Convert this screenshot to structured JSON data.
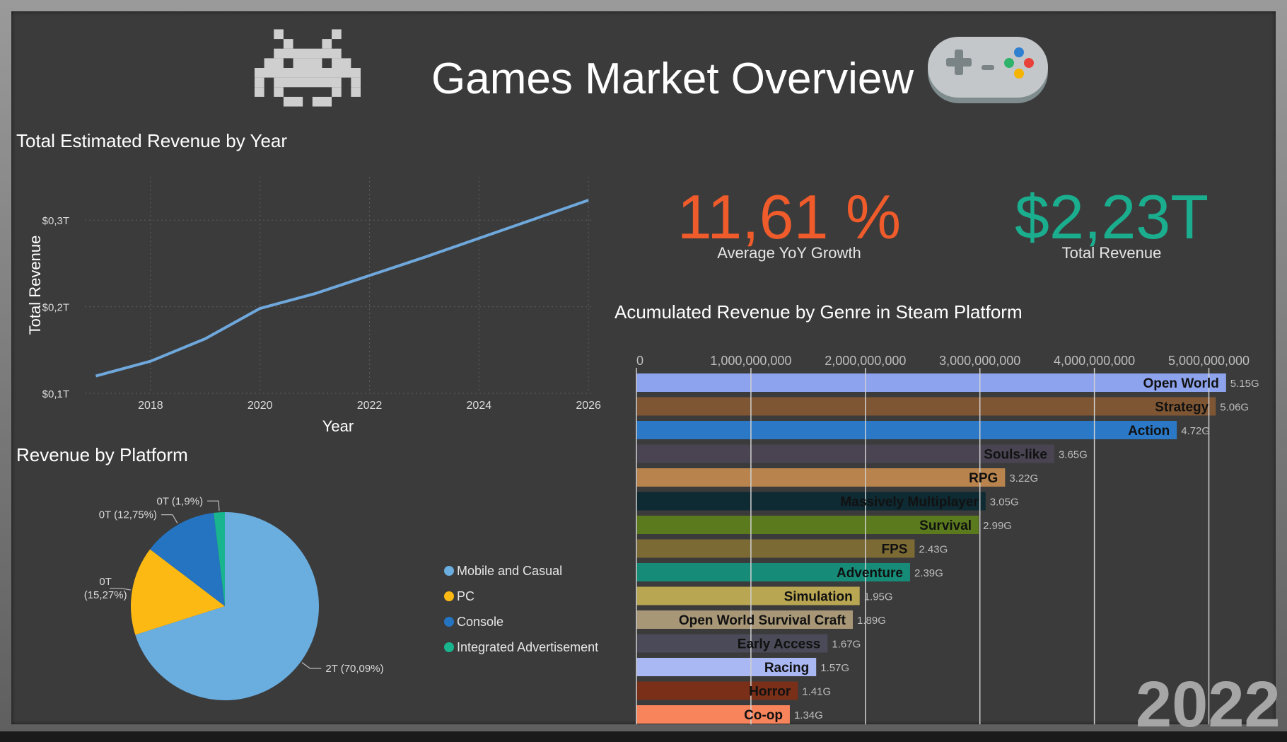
{
  "header": {
    "title": "Games Market Overview",
    "left_icon": "space-invader-icon",
    "right_icon": "gamepad-icon"
  },
  "kpis": {
    "growth": {
      "value": "11,61 %",
      "label": "Average YoY Growth",
      "color": "#ef5b2b"
    },
    "revenue": {
      "value": "$2,23T",
      "label": "Total Revenue",
      "color": "#1aae8f"
    }
  },
  "year_label": "2022",
  "line_chart_title": "Total Estimated Revenue by Year",
  "pie_chart_title": "Revenue by Platform",
  "bar_chart_title": "Acumulated Revenue by Genre in Steam Platform",
  "chart_data": [
    {
      "type": "line",
      "title": "Total Estimated Revenue by Year",
      "xlabel": "Year",
      "ylabel": "Total Revenue",
      "x": [
        2017,
        2018,
        2019,
        2020,
        2021,
        2022,
        2023,
        2024,
        2025,
        2026
      ],
      "series": [
        {
          "values": [
            0.12,
            0.137,
            0.163,
            0.198,
            0.215,
            0.236,
            0.257,
            0.279,
            0.301,
            0.323
          ]
        }
      ],
      "xticks": [
        "2018",
        "2020",
        "2022",
        "2024",
        "2026"
      ],
      "yticks": [
        "$0,1T",
        "$0,2T",
        "$0,3T"
      ],
      "ytick_values": [
        0.1,
        0.2,
        0.3
      ],
      "xlim": [
        2016.8,
        2026.05
      ],
      "ylim": [
        0.1,
        0.35
      ],
      "grid": true,
      "color": "#6fa8dc"
    },
    {
      "type": "pie",
      "title": "Revenue by Platform",
      "categories": [
        "Mobile and Casual",
        "PC",
        "Console",
        "Integrated Advertisement"
      ],
      "values": [
        70.09,
        15.27,
        12.75,
        1.9
      ],
      "labels": [
        "2T (70,09%)",
        "0T (15,27%)",
        "0T (12,75%)",
        "0T (1,9%)"
      ],
      "colors": [
        "#6aaee0",
        "#fdb913",
        "#2474c2",
        "#19b58f"
      ],
      "legend": "right"
    },
    {
      "type": "bar",
      "orientation": "horizontal",
      "title": "Acumulated Revenue by Genre in Steam Platform",
      "categories": [
        "Open World",
        "Strategy",
        "Action",
        "Souls-like",
        "RPG",
        "Massively Multiplayer",
        "Survival",
        "FPS",
        "Adventure",
        "Simulation",
        "Open World Survival Craft",
        "Early Access",
        "Racing",
        "Horror",
        "Co-op"
      ],
      "values": [
        5150000000,
        5060000000,
        4720000000,
        3650000000,
        3220000000,
        3050000000,
        2990000000,
        2430000000,
        2390000000,
        1950000000,
        1890000000,
        1670000000,
        1570000000,
        1410000000,
        1340000000
      ],
      "value_labels": [
        "5.15G",
        "5.06G",
        "4.72G",
        "3.65G",
        "3.22G",
        "3.05G",
        "2.99G",
        "2.43G",
        "2.39G",
        "1.95G",
        "1.89G",
        "1.67G",
        "1.57G",
        "1.41G",
        "1.34G"
      ],
      "colors": [
        "#8ea3ee",
        "#7f5633",
        "#2b78c7",
        "#4a4452",
        "#b8834c",
        "#0e2a33",
        "#5b7a1e",
        "#7b6a33",
        "#168c78",
        "#b8a652",
        "#a89776",
        "#4a4a58",
        "#a9b7f2",
        "#7a2f18",
        "#f7845b"
      ],
      "xticks": [
        "0",
        "1,000,000,000",
        "2,000,000,000",
        "3,000,000,000",
        "4,000,000,000",
        "5,000,000,000"
      ],
      "xtick_values": [
        0,
        1000000000,
        2000000000,
        3000000000,
        4000000000,
        5000000000
      ],
      "xlim": [
        0,
        5250000000
      ],
      "grid": true
    }
  ]
}
